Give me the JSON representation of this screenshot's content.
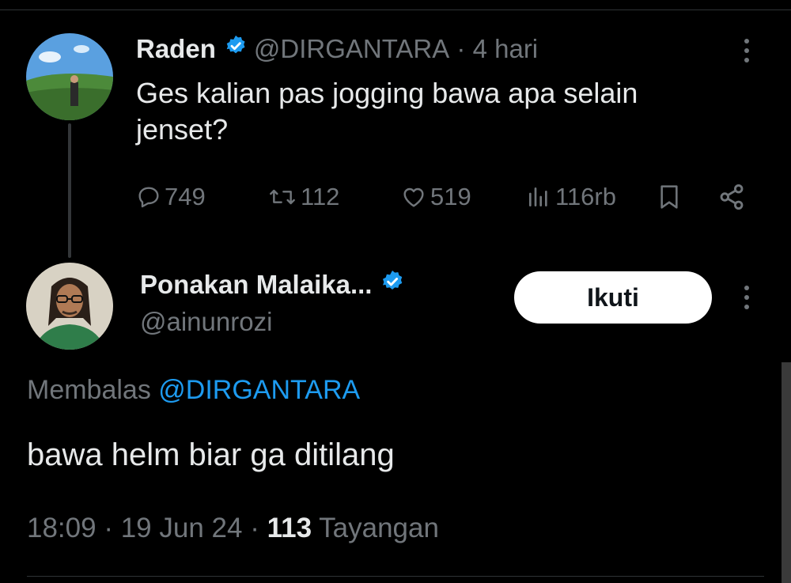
{
  "original_tweet": {
    "author_name": "Raden",
    "author_handle": "@DIRGANTARA",
    "time_ago": "4 hari",
    "text": "Ges kalian pas jogging bawa apa selain jenset?",
    "stats": {
      "replies": "749",
      "retweets": "112",
      "likes": "519",
      "views": "116rb"
    }
  },
  "reply_tweet": {
    "author_name": "Ponakan Malaika...",
    "author_handle": "@ainunrozi",
    "follow_label": "Ikuti",
    "replying_prefix": "Membalas",
    "replying_to": "@DIRGANTARA",
    "text": "bawa helm biar ga ditilang",
    "time": "18:09",
    "date": "19 Jun 24",
    "views_count": "113",
    "views_label": "Tayangan"
  },
  "icons": {
    "verified": "verified-badge-icon",
    "more": "more-options-icon",
    "reply": "reply-icon",
    "retweet": "retweet-icon",
    "like": "heart-icon",
    "views": "views-chart-icon",
    "bookmark": "bookmark-icon",
    "share": "share-icon"
  },
  "colors": {
    "background": "#000000",
    "text": "#e7e9ea",
    "muted": "#71767b",
    "accent": "#1d9bf0",
    "button_bg": "#ffffff"
  }
}
